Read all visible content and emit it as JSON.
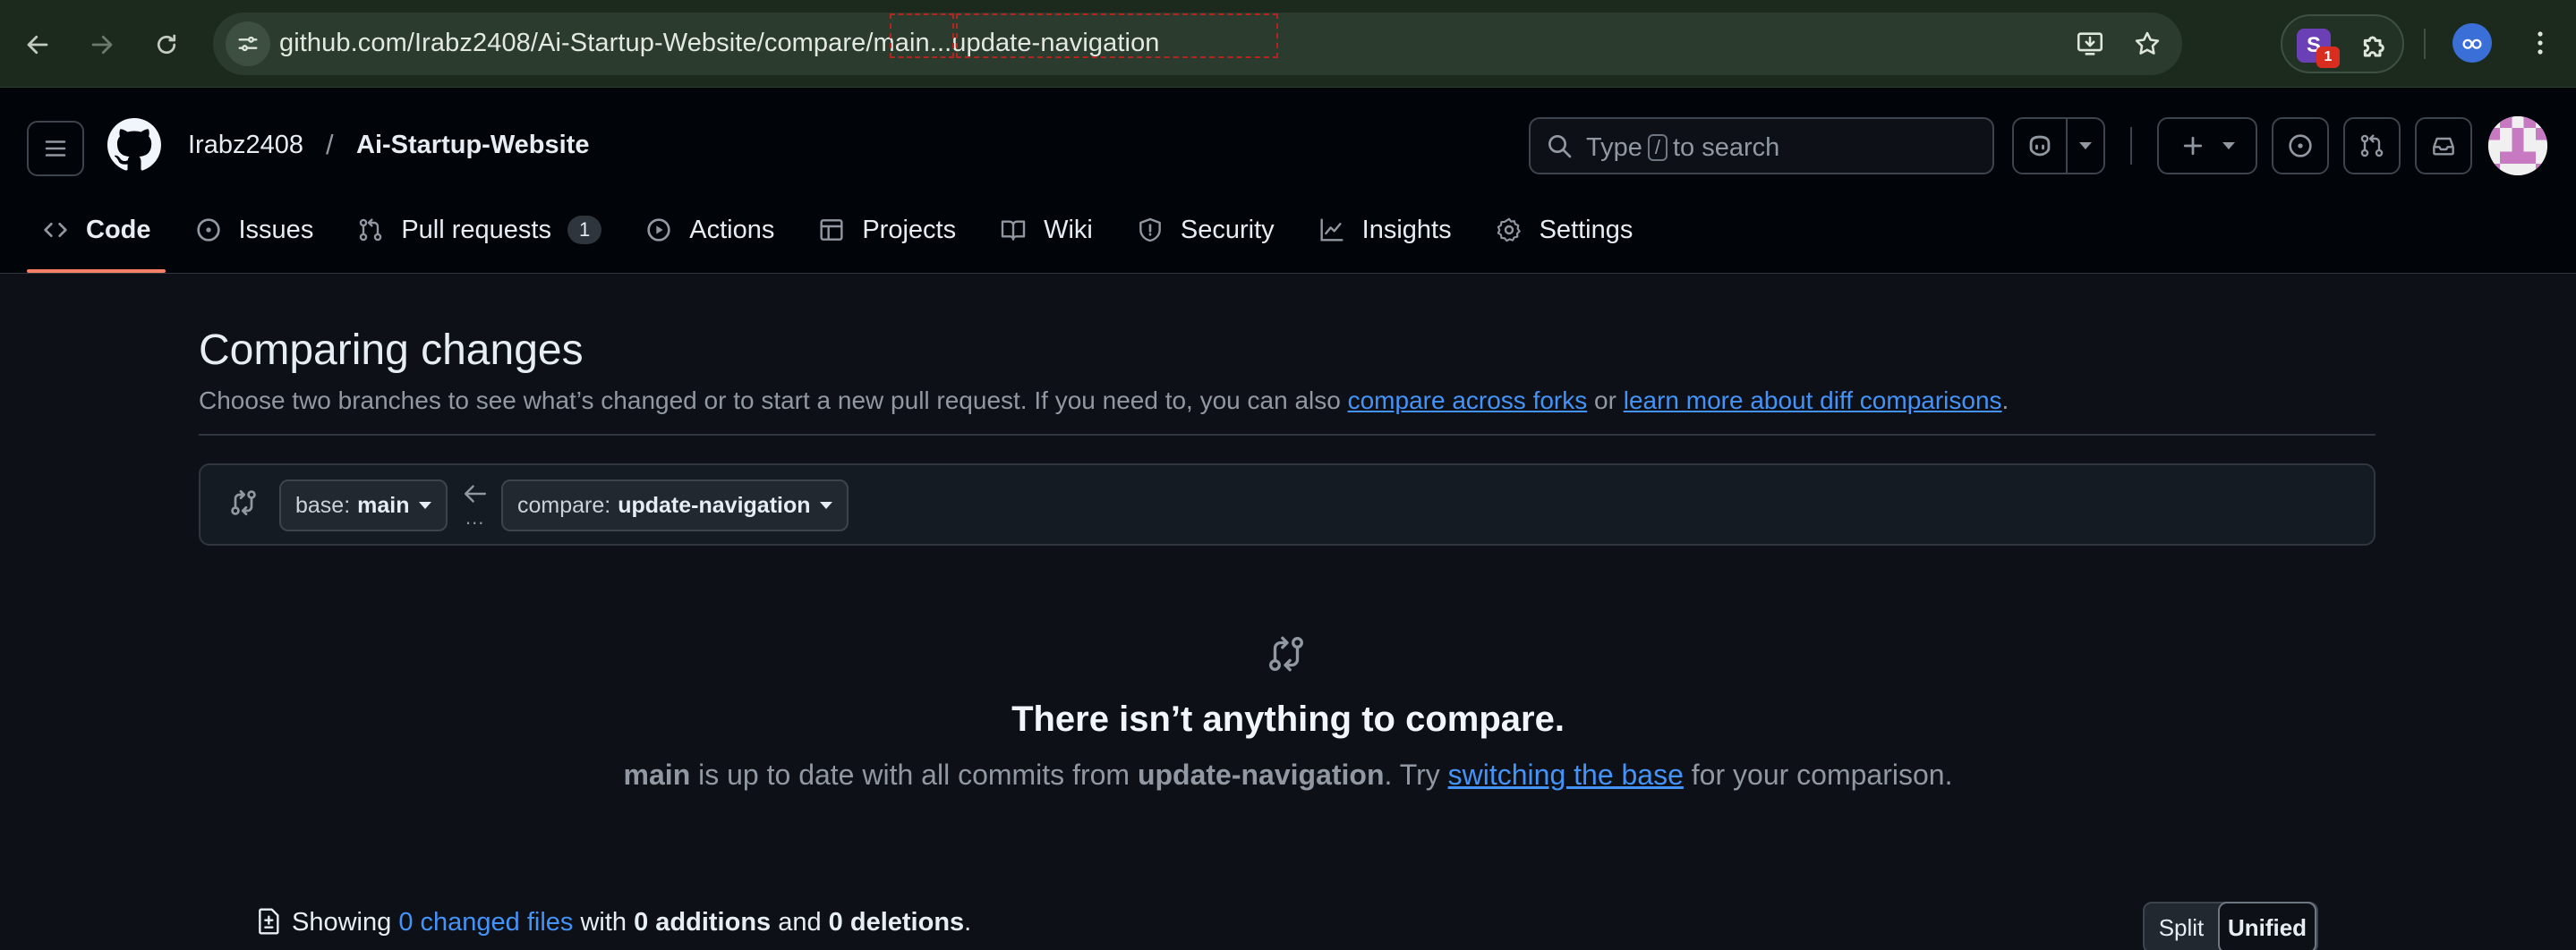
{
  "browser": {
    "url": "github.com/Irabz2408/Ai-Startup-Website/compare/main...update-navigation",
    "extension_badge": "1",
    "extension_letter": "S"
  },
  "header": {
    "owner": "Irabz2408",
    "separator": "/",
    "repo": "Ai-Startup-Website",
    "search": {
      "prefix": "Type",
      "key": "/",
      "suffix": "to search"
    }
  },
  "tabs": [
    {
      "label": "Code",
      "icon": "code-icon",
      "active": true
    },
    {
      "label": "Issues",
      "icon": "issue-icon"
    },
    {
      "label": "Pull requests",
      "icon": "pull-request-icon",
      "count": "1"
    },
    {
      "label": "Actions",
      "icon": "play-icon"
    },
    {
      "label": "Projects",
      "icon": "table-icon"
    },
    {
      "label": "Wiki",
      "icon": "book-icon"
    },
    {
      "label": "Security",
      "icon": "shield-icon"
    },
    {
      "label": "Insights",
      "icon": "graph-icon"
    },
    {
      "label": "Settings",
      "icon": "gear-icon"
    }
  ],
  "main": {
    "title": "Comparing changes",
    "subtitle_prefix": "Choose two branches to see what’s changed or to start a new pull request. If you need to, you can also ",
    "link_forks": "compare across forks",
    "subtitle_or": " or ",
    "link_diff": "learn more about diff comparisons",
    "subtitle_end": "."
  },
  "range": {
    "base_label": "base:",
    "base_value": "main",
    "compare_label": "compare:",
    "compare_value": "update-navigation",
    "dots": "..."
  },
  "empty": {
    "title": "There isn’t anything to compare.",
    "base": "main",
    "mid": " is up to date with all commits from ",
    "head": "update-navigation",
    "try": ". Try ",
    "link": "switching the base",
    "end": " for your comparison."
  },
  "files": {
    "showing": "Showing ",
    "changed": "0 changed files",
    "with": " with ",
    "additions": "0 additions",
    "and": " and ",
    "deletions": "0 deletions",
    "end": "."
  },
  "view": {
    "split": "Split",
    "unified": "Unified"
  },
  "colors": {
    "accent": "#f78166",
    "link": "#4493f8",
    "bg": "#0d1117",
    "header_bg": "#010409"
  }
}
